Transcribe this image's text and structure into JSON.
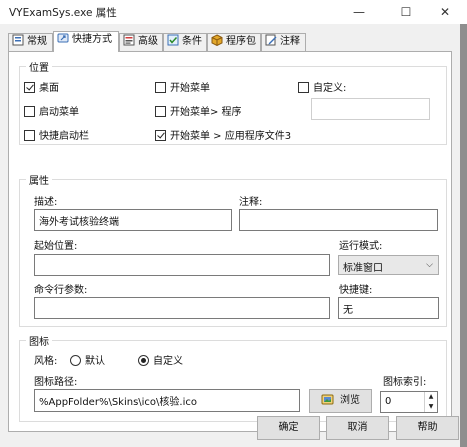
{
  "window": {
    "title": "VYExamSys.exe 属性",
    "minimize": "—",
    "maximize": "☐",
    "close": "✕"
  },
  "tabs": [
    {
      "label": "常规",
      "icon": "general-icon"
    },
    {
      "label": "快捷方式",
      "icon": "shortcut-icon",
      "active": true
    },
    {
      "label": "高级",
      "icon": "advanced-icon"
    },
    {
      "label": "条件",
      "icon": "conditions-icon"
    },
    {
      "label": "程序包",
      "icon": "package-icon"
    },
    {
      "label": "注释",
      "icon": "notes-icon"
    }
  ],
  "location": {
    "group_title": "位置",
    "desktop": {
      "label": "桌面",
      "checked": true
    },
    "start_menu": {
      "label": "开始菜单",
      "checked": false
    },
    "custom": {
      "label": "自定义:",
      "checked": false
    },
    "startup_menu": {
      "label": "启动菜单",
      "checked": false
    },
    "start_programs": {
      "label": "开始菜单> 程序",
      "checked": false
    },
    "quick_launch": {
      "label": "快捷启动栏",
      "checked": false
    },
    "start_app_files": {
      "label": "开始菜单 > 应用程序文件3",
      "checked": true
    },
    "custom_value": ""
  },
  "properties": {
    "group_title": "属性",
    "description_label": "描述:",
    "description_value": "海外考试核验终端",
    "comment_label": "注释:",
    "comment_value": "",
    "start_in_label": "起始位置:",
    "start_in_value": "",
    "run_mode_label": "运行模式:",
    "run_mode_value": "标准窗口",
    "args_label": "命令行参数:",
    "args_value": "",
    "hotkey_label": "快捷键:",
    "hotkey_value": "无"
  },
  "icon": {
    "group_title": "图标",
    "style_label": "风格:",
    "style_default": {
      "label": "默认",
      "checked": false
    },
    "style_custom": {
      "label": "自定义",
      "checked": true
    },
    "path_label": "图标路径:",
    "path_value": "%AppFolder%\\Skins\\ico\\核验.ico",
    "browse_label": "浏览",
    "index_label": "图标索引:",
    "index_value": "0"
  },
  "footer": {
    "ok": "确定",
    "cancel": "取消",
    "help": "帮助"
  }
}
